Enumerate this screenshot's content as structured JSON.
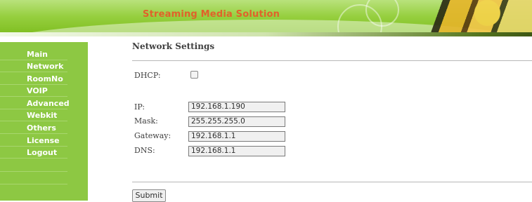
{
  "banner": {
    "title": "Streaming Media Solution"
  },
  "sidebar": {
    "items": [
      {
        "label": "Main"
      },
      {
        "label": "Network"
      },
      {
        "label": "RoomNo"
      },
      {
        "label": "VOIP"
      },
      {
        "label": "Advanced"
      },
      {
        "label": "Webkit"
      },
      {
        "label": "Others"
      },
      {
        "label": "License"
      },
      {
        "label": "Logout"
      }
    ]
  },
  "main": {
    "title": "Network Settings",
    "dhcp_label": "DHCP:",
    "dhcp_checked": false,
    "fields": [
      {
        "label": "IP:",
        "value": "192.168.1.190"
      },
      {
        "label": "Mask:",
        "value": "255.255.255.0"
      },
      {
        "label": "Gateway:",
        "value": "192.168.1.1"
      },
      {
        "label": "DNS:",
        "value": "192.168.1.1"
      }
    ],
    "submit_label": "Submit"
  },
  "colors": {
    "sidebar_bg": "#8dc843",
    "banner_title": "#e0622a"
  }
}
